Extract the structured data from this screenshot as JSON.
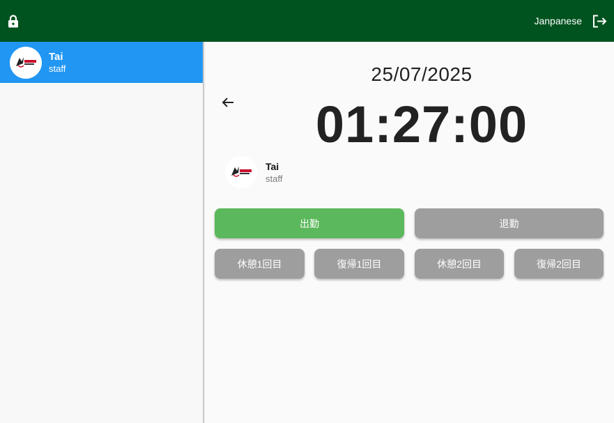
{
  "header": {
    "language_label": "Janpanese",
    "lock_icon": "lock-icon",
    "logout_icon": "logout-icon",
    "bg_color": "#00531f"
  },
  "sidebar": {
    "items": [
      {
        "name": "Tai",
        "role": "staff",
        "selected": true,
        "highlight_color": "#2196f3"
      }
    ]
  },
  "main": {
    "date": "25/07/2025",
    "time": "01:27:00",
    "profile": {
      "name": "Tai",
      "role": "staff"
    },
    "buttons": {
      "clock_in": "出勤",
      "clock_out": "退勤",
      "break1_start": "休憩1回目",
      "break1_end": "復帰1回目",
      "break2_start": "休憩2回目",
      "break2_end": "復帰2回目"
    },
    "colors": {
      "clock_in": "#5cb85c",
      "disabled": "#9e9e9e"
    }
  }
}
